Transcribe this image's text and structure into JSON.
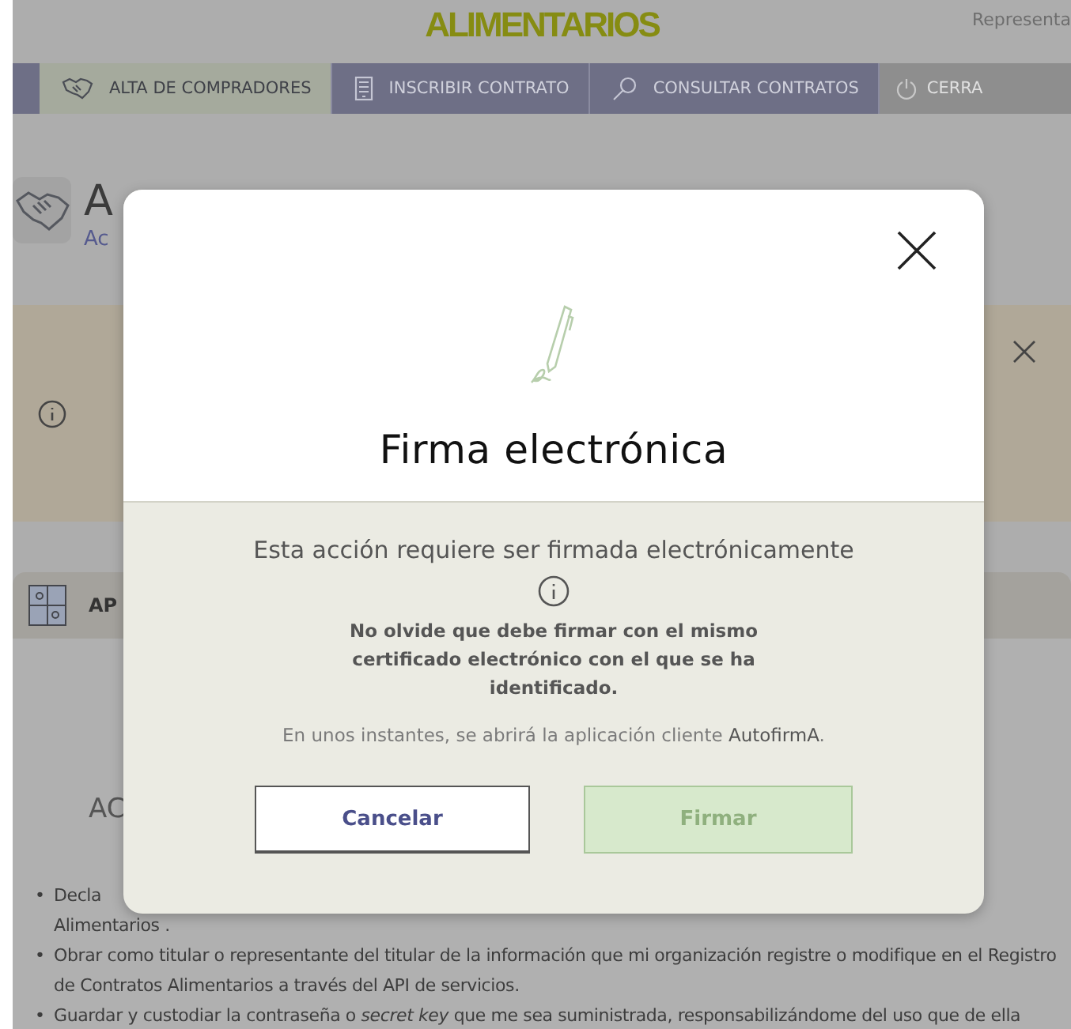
{
  "header": {
    "title": "ALIMENTARIOS",
    "user": "Representa"
  },
  "nav": [
    {
      "label": "ALTA DE COMPRADORES",
      "selected": true
    },
    {
      "label": "INSCRIBIR CONTRATO",
      "selected": false
    },
    {
      "label": "CONSULTAR CONTRATOS",
      "selected": false
    },
    {
      "label": "CERRA",
      "selected": false
    }
  ],
  "page": {
    "heading": "A",
    "subheading": "Ac"
  },
  "card": {
    "title": "AP",
    "section_heading": "AC",
    "bullets": [
      {
        "marker": "•",
        "text": "Decla",
        "continuation": "Alimentarios ."
      },
      {
        "marker": "•",
        "text": "Obrar como titular o representante del titular de la información que mi organización registre o modifique en el Registro de Contratos Alimentarios a través del API de servicios."
      },
      {
        "marker": "•",
        "text": "Guardar y custodiar la contraseña o *secret key* que me sea suministrada, responsabilizándome del uso que de ella"
      }
    ]
  },
  "dialog": {
    "title": "Firma electrónica",
    "message": "Esta acción requiere ser firmada electrónicamente",
    "warning": "No olvide que debe firmar con el mismo certificado electrónico con el que se ha identificado.",
    "note": "En unos instantes, se abrirá la aplicación cliente **AutofirmA**.",
    "buttons": [
      {
        "label": "Cancelar",
        "kind": "secondary"
      },
      {
        "label": "Firmar",
        "kind": "primary"
      }
    ]
  }
}
